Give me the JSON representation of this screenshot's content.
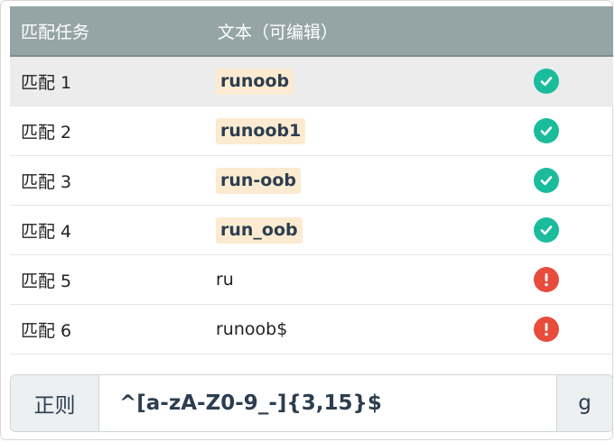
{
  "header": {
    "task_label": "匹配任务",
    "text_label": "文本（可编辑）"
  },
  "rows": [
    {
      "task": "匹配 1",
      "text": "runoob",
      "matched": true,
      "status_icon": "check-circle-icon"
    },
    {
      "task": "匹配 2",
      "text": "runoob1",
      "matched": true,
      "status_icon": "check-circle-icon"
    },
    {
      "task": "匹配 3",
      "text": "run-oob",
      "matched": true,
      "status_icon": "check-circle-icon"
    },
    {
      "task": "匹配 4",
      "text": "run_oob",
      "matched": true,
      "status_icon": "check-circle-icon"
    },
    {
      "task": "匹配 5",
      "text": "ru",
      "matched": false,
      "status_icon": "exclamation-circle-icon"
    },
    {
      "task": "匹配 6",
      "text": "runoob$",
      "matched": false,
      "status_icon": "exclamation-circle-icon"
    }
  ],
  "regex": {
    "prefix_label": "正则",
    "value": "^[a-zA-Z0-9_-]{3,15}$",
    "flags": "g"
  },
  "colors": {
    "header_bg": "#95a5a6",
    "match_bg": "#fcebd0",
    "ok": "#1abc9c",
    "error": "#e74c3c"
  }
}
